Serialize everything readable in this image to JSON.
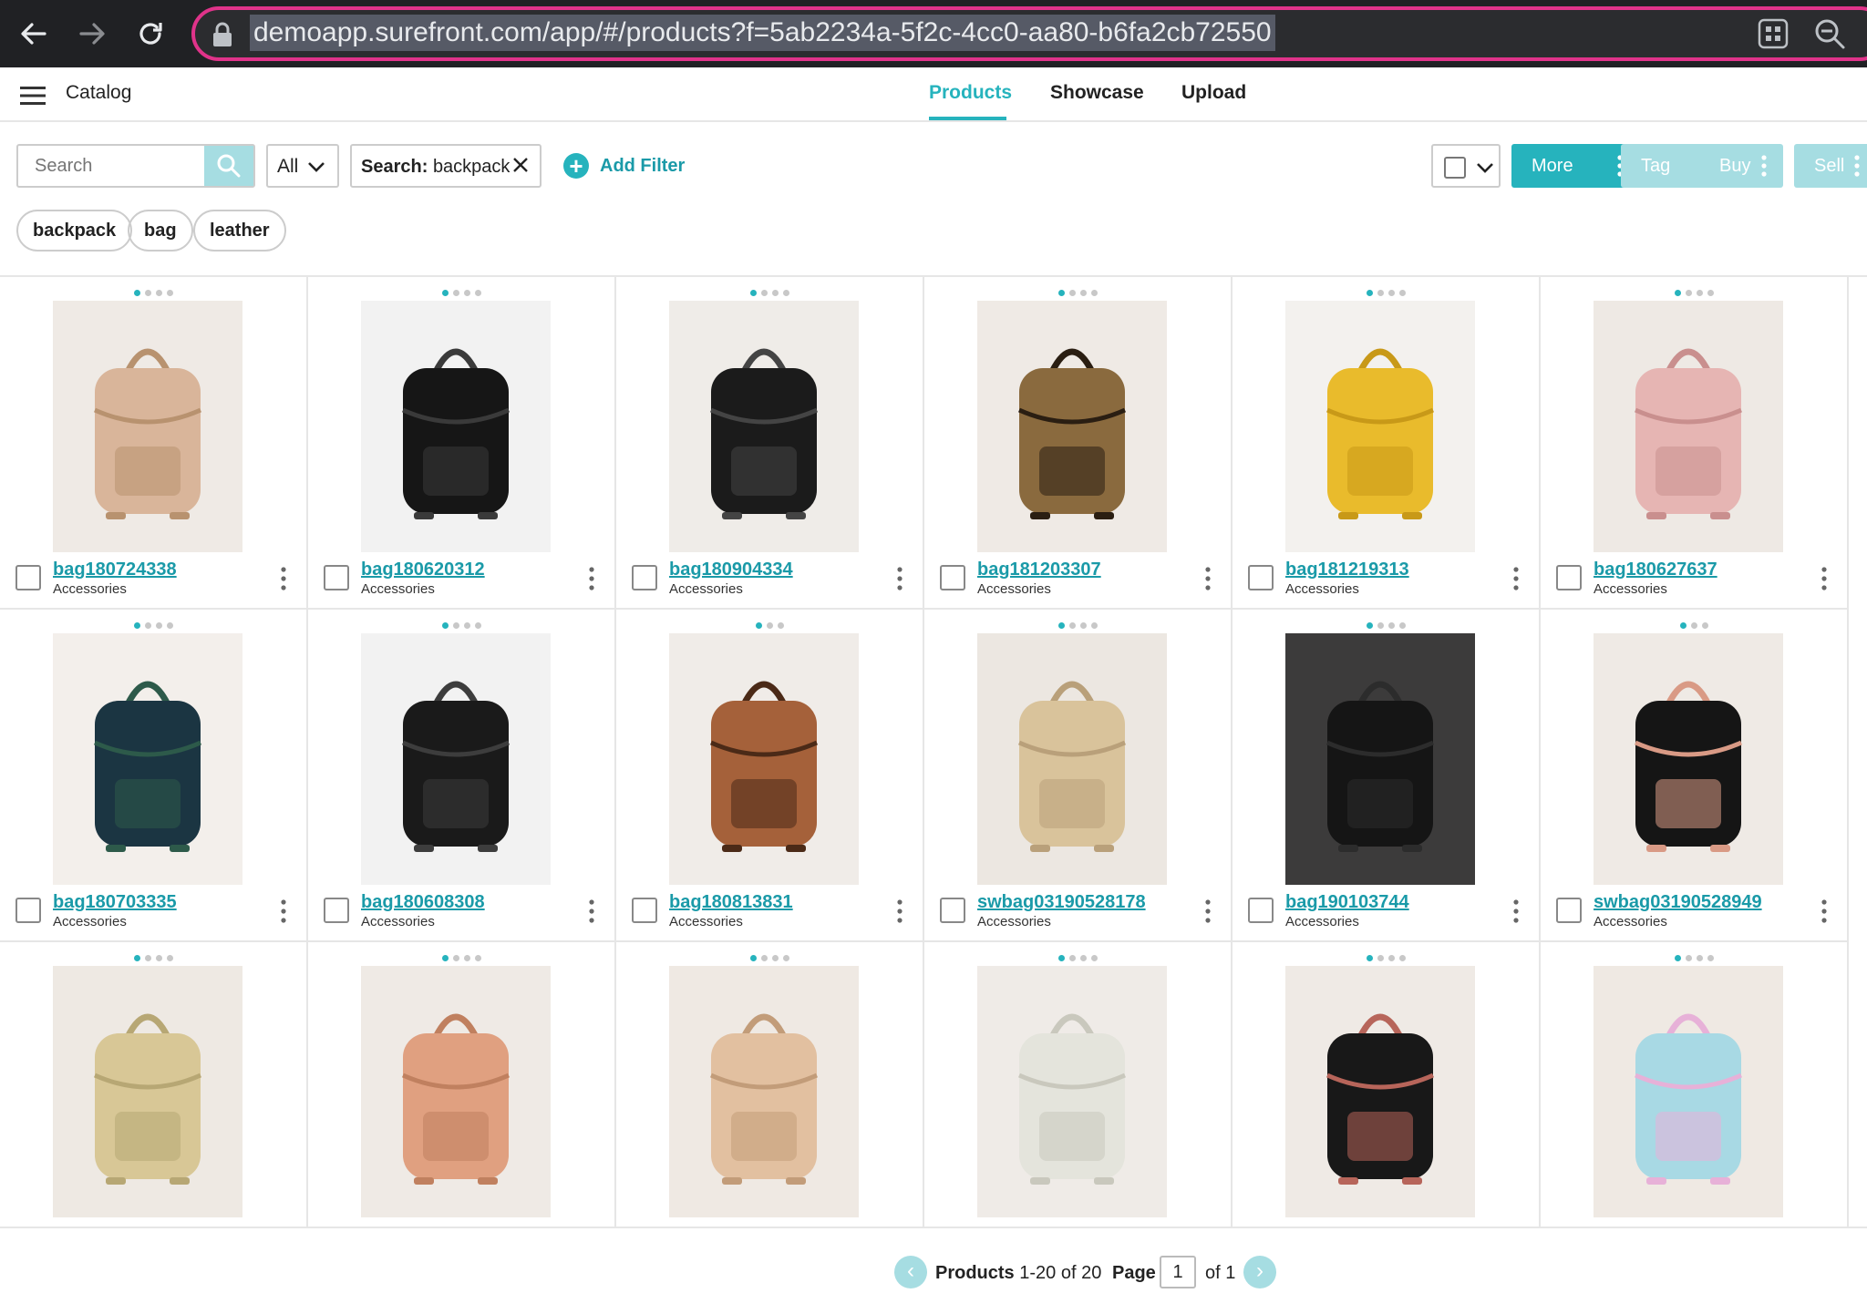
{
  "browser": {
    "url": "demoapp.surefront.com/app/#/products?f=5ab2234a-5f2c-4cc0-aa80-b6fa2cb72550"
  },
  "header": {
    "title": "Catalog",
    "tabs": [
      {
        "label": "Products",
        "active": true
      },
      {
        "label": "Showcase",
        "active": false
      },
      {
        "label": "Upload",
        "active": false
      }
    ]
  },
  "toolbar": {
    "search_placeholder": "Search",
    "scope_select": "All",
    "active_filter_key": "Search:",
    "active_filter_value": "backpack",
    "add_filter_label": "Add Filter",
    "more_label": "More",
    "tag_label": "Tag",
    "buy_label": "Buy",
    "sell_label": "Sell"
  },
  "tags": [
    "backpack",
    "bag",
    "leather"
  ],
  "products": [
    {
      "name": "bag180724338",
      "category": "Accessories",
      "dots": 4,
      "icon": "backpack-beige"
    },
    {
      "name": "bag180620312",
      "category": "Accessories",
      "dots": 4,
      "icon": "backpack-black-laced"
    },
    {
      "name": "bag180904334",
      "category": "Accessories",
      "dots": 4,
      "icon": "backpack-black-striped"
    },
    {
      "name": "bag181203307",
      "category": "Accessories",
      "dots": 4,
      "icon": "backpack-leopard"
    },
    {
      "name": "bag181219313",
      "category": "Accessories",
      "dots": 4,
      "icon": "backpack-yellow"
    },
    {
      "name": "bag180627637",
      "category": "Accessories",
      "dots": 4,
      "icon": "drawstring-pink-metallic"
    },
    {
      "name": "bag180703335",
      "category": "Accessories",
      "dots": 4,
      "icon": "backpack-plaid"
    },
    {
      "name": "bag180608308",
      "category": "Accessories",
      "dots": 4,
      "icon": "backpack-black-flap"
    },
    {
      "name": "bag180813831",
      "category": "Accessories",
      "dots": 3,
      "icon": "backpack-brown-round"
    },
    {
      "name": "swbag03190528178",
      "category": "Accessories",
      "dots": 4,
      "icon": "backpack-straw"
    },
    {
      "name": "bag190103744",
      "category": "Accessories",
      "dots": 4,
      "icon": "backpack-black-leather"
    },
    {
      "name": "swbag03190528949",
      "category": "Accessories",
      "dots": 3,
      "icon": "backpack-black-canvas"
    },
    {
      "name": "",
      "category": "",
      "dots": 4,
      "icon": "backpack-straw-pearl"
    },
    {
      "name": "",
      "category": "",
      "dots": 4,
      "icon": "backpack-pink-croc"
    },
    {
      "name": "",
      "category": "",
      "dots": 4,
      "icon": "backpack-straw-mini"
    },
    {
      "name": "",
      "category": "",
      "dots": 4,
      "icon": "backpack-silver"
    },
    {
      "name": "",
      "category": "",
      "dots": 4,
      "icon": "backpack-black-floral"
    },
    {
      "name": "",
      "category": "",
      "dots": 4,
      "icon": "backpack-holographic"
    }
  ],
  "pagination": {
    "products_label": "Products",
    "range_text": "1-20 of 20",
    "page_label": "Page",
    "page_value": "1",
    "of_text": "of 1"
  },
  "colors": {
    "accent": "#26b3bd",
    "accent_light": "#a6dde2",
    "link": "#1a9aa8",
    "url_highlight": "#e0338a"
  }
}
